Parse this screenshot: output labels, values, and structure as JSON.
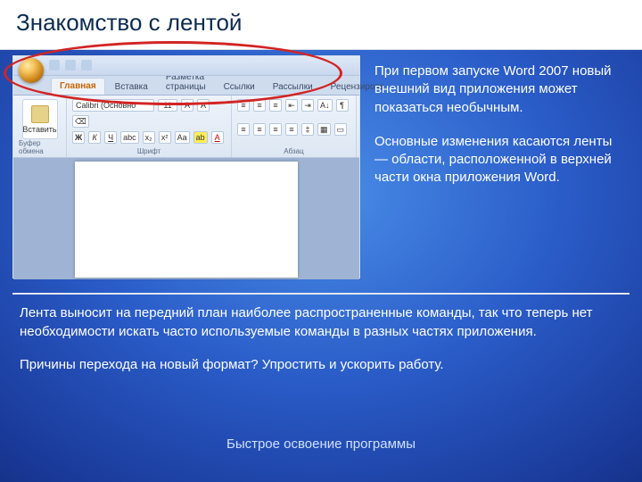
{
  "title": "Знакомство с лентой",
  "side": {
    "p1": "При первом запуске Word 2007 новый внешний вид приложения может показаться необычным.",
    "p2": "Основные изменения касаются ленты — области, расположенной в верхней части окна приложения Word."
  },
  "bottom": {
    "p1": "Лента выносит на передний план наиболее распространенные команды, так что теперь нет необходимости искать часто используемые команды в разных частях приложения.",
    "p2": "Причины перехода на новый формат? Упростить и ускорить работу."
  },
  "footer": "Быстрое освоение программы",
  "word": {
    "tabs": [
      "Главная",
      "Вставка",
      "Разметка страницы",
      "Ссылки",
      "Рассылки",
      "Рецензирова"
    ],
    "paste": "Вставить",
    "font": "Calibri (Основно",
    "size": "11",
    "groups": {
      "clipboard": "Буфер обмена",
      "font": "Шрифт",
      "para": "Абзац"
    }
  }
}
